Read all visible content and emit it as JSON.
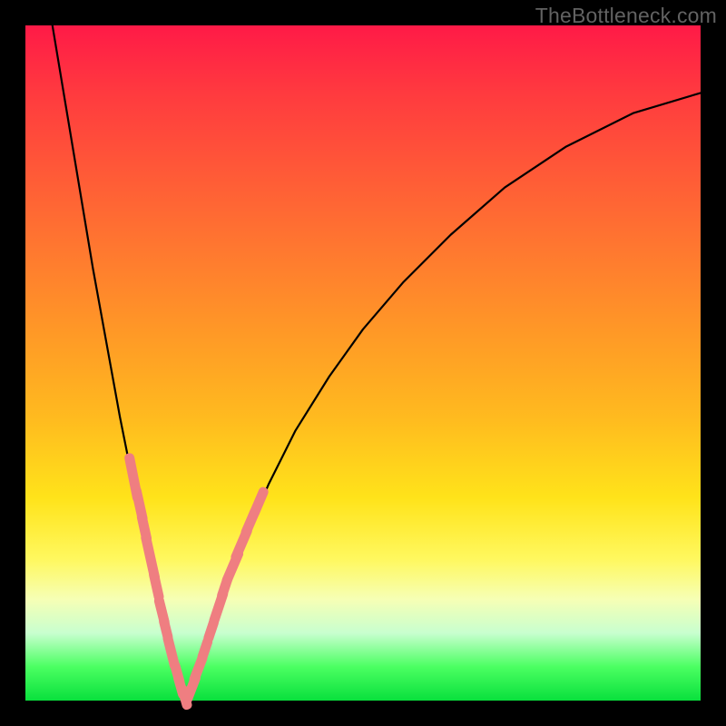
{
  "watermark": "TheBottleneck.com",
  "colors": {
    "frame_bg": "#000000",
    "gradient_top": "#ff1a47",
    "gradient_bottom": "#09e03d",
    "curve_stroke": "#000000",
    "marker_fill": "#ef7e81",
    "watermark_text": "#626262"
  },
  "chart_data": {
    "type": "line",
    "title": "",
    "xlabel": "",
    "ylabel": "",
    "xlim": [
      0,
      100
    ],
    "ylim": [
      0,
      100
    ],
    "description": "Bottleneck curve: two branches meeting at x≈24, y=0. Left branch falls from top-left, right branch rises to upper-right. Pink rounded markers cluster along both branches near the valley.",
    "series": [
      {
        "name": "left_branch",
        "x": [
          4,
          6,
          8,
          10,
          12,
          14,
          16,
          18,
          20,
          22,
          23.7
        ],
        "values": [
          100,
          88,
          76,
          64,
          53,
          42,
          32,
          23,
          14,
          6,
          0
        ]
      },
      {
        "name": "right_branch",
        "x": [
          23.7,
          26,
          28,
          30,
          33,
          36,
          40,
          45,
          50,
          56,
          63,
          71,
          80,
          90,
          100
        ],
        "values": [
          0,
          6,
          12,
          18,
          25,
          32,
          40,
          48,
          55,
          62,
          69,
          76,
          82,
          87,
          90
        ]
      }
    ],
    "markers": [
      {
        "branch": "left",
        "x": 16.0,
        "y": 33.0,
        "len": 7
      },
      {
        "branch": "left",
        "x": 16.9,
        "y": 29.0,
        "len": 5
      },
      {
        "branch": "left",
        "x": 17.6,
        "y": 25.6,
        "len": 4
      },
      {
        "branch": "left",
        "x": 18.5,
        "y": 21.2,
        "len": 7
      },
      {
        "branch": "left",
        "x": 19.4,
        "y": 17.0,
        "len": 4
      },
      {
        "branch": "left",
        "x": 20.2,
        "y": 13.2,
        "len": 4
      },
      {
        "branch": "left",
        "x": 20.8,
        "y": 10.6,
        "len": 3
      },
      {
        "branch": "left",
        "x": 21.6,
        "y": 7.2,
        "len": 5
      },
      {
        "branch": "left",
        "x": 22.5,
        "y": 4.0,
        "len": 3
      },
      {
        "branch": "left",
        "x": 23.0,
        "y": 2.1,
        "len": 3
      },
      {
        "branch": "left",
        "x": 23.6,
        "y": 0.5,
        "len": 3
      },
      {
        "branch": "right",
        "x": 24.6,
        "y": 1.8,
        "len": 4
      },
      {
        "branch": "right",
        "x": 25.6,
        "y": 4.7,
        "len": 4
      },
      {
        "branch": "right",
        "x": 26.6,
        "y": 7.6,
        "len": 3
      },
      {
        "branch": "right",
        "x": 27.5,
        "y": 10.4,
        "len": 3
      },
      {
        "branch": "right",
        "x": 28.6,
        "y": 13.8,
        "len": 5
      },
      {
        "branch": "right",
        "x": 29.5,
        "y": 16.7,
        "len": 3
      },
      {
        "branch": "right",
        "x": 30.7,
        "y": 19.8,
        "len": 5
      },
      {
        "branch": "right",
        "x": 32.0,
        "y": 23.2,
        "len": 5
      },
      {
        "branch": "right",
        "x": 33.3,
        "y": 26.4,
        "len": 4
      },
      {
        "branch": "right",
        "x": 34.6,
        "y": 29.4,
        "len": 4
      }
    ]
  }
}
